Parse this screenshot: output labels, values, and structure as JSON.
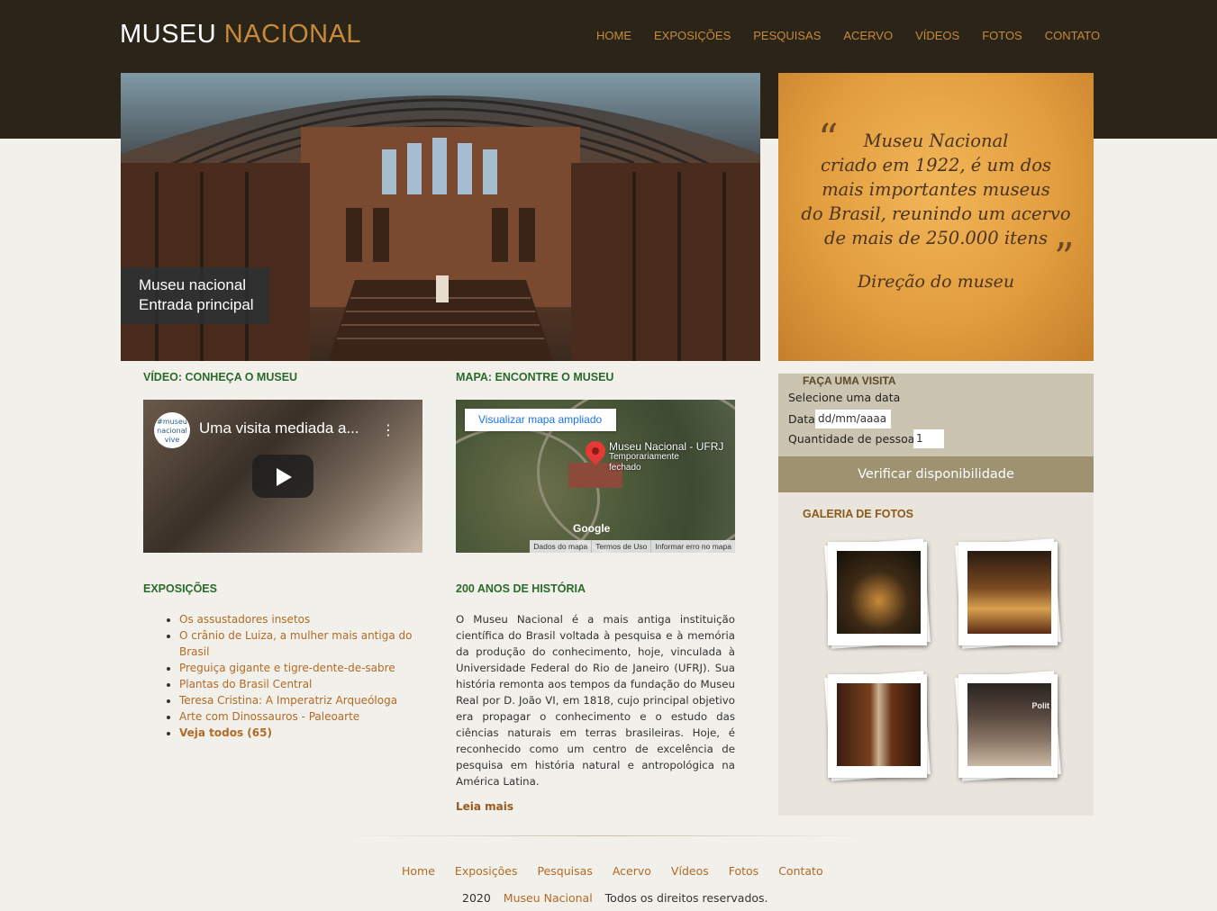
{
  "header": {
    "logo_part1": "MUSEU",
    "logo_part2": "NACIONAL",
    "nav": [
      "HOME",
      "EXPOSIÇÕES",
      "PESQUISAS",
      "ACERVO",
      "VÍDEOS",
      "FOTOS",
      "CONTATO"
    ]
  },
  "hero": {
    "caption_line1": "Museu nacional",
    "caption_line2": "Entrada principal"
  },
  "quote": {
    "open_mark": "“",
    "close_mark": "”",
    "lines": [
      "Museu Nacional",
      "criado em 1922, é um dos",
      "mais importantes museus",
      "do Brasil, reunindo um acervo",
      "de mais de 250.000 itens"
    ],
    "author": "Direção do museu"
  },
  "video_section": {
    "heading": "VÍDEO: CONHEÇA O MUSEU",
    "badge": "#museu nacional vive",
    "title": "Uma visita mediada a...",
    "more": "⋮"
  },
  "map_section": {
    "heading": "MAPA: ENCONTRE O MUSEU",
    "button": "Visualizar mapa ampliado",
    "place_name": "Museu Nacional - UFRJ",
    "place_status_1": "Temporariamente",
    "place_status_2": "fechado",
    "logo": "Google",
    "footer": [
      "Dados do mapa",
      "Termos de Uso",
      "Informar erro no mapa"
    ]
  },
  "exhibitions": {
    "heading": "EXPOSIÇÕES",
    "items": [
      "Os assustadores insetos",
      "O crânio de Luiza, a mulher mais antiga do Brasil",
      "Preguiça gigante e tigre-dente-de-sabre",
      "Plantas do Brasil Central",
      "Teresa Cristina: A Imperatriz Arqueóloga",
      "Arte com Dinossauros - Paleoarte",
      "Veja todos (65)"
    ]
  },
  "history": {
    "heading": "200 ANOS DE HISTÓRIA",
    "body": "O Museu Nacional é a mais antiga instituição científica do Brasil voltada à pesquisa e à memória da produção do conhecimento, hoje, vinculada à Universidade Federal do Rio de Janeiro (UFRJ). Sua história remonta aos tempos da fundação do Museu Real por D. João VI, em 1818, cujo principal objetivo era propagar o conhecimento e o estudo das ciências naturais em terras brasileiras. Hoje, é reconhecido como um centro de excelência de pesquisa em história natural e antropológica na América Latina.",
    "read_more": "Leia mais"
  },
  "visit": {
    "heading": "FAÇA UMA VISITA",
    "subtitle": "Selecione uma data",
    "date_label": "Data",
    "date_placeholder": "dd/mm/aaaa",
    "people_label": "Quantidade de pessoas",
    "people_value": "1",
    "button": "Verificar disponibilidade"
  },
  "gallery": {
    "heading": "GALERIA DE FOTOS",
    "photo_tag": "Polit"
  },
  "footer": {
    "nav": [
      "Home",
      "Exposições",
      "Pesquisas",
      "Acervo",
      "Vídeos",
      "Fotos",
      "Contato"
    ],
    "year": "2020",
    "brand": "Museu Nacional",
    "rights": "Todos os direitos reservados."
  }
}
